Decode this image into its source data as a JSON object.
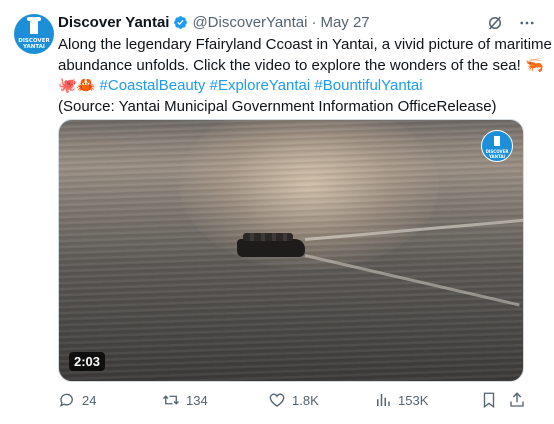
{
  "account": {
    "name": "Discover Yantai",
    "handle": "@DiscoverYantai",
    "separator": "·",
    "date": "May 27",
    "avatar_text": "DISCOVER YANTAI"
  },
  "tweet": {
    "line1": "Along the legendary Ffairyland Ccoast in Yantai, a vivid picture of maritime",
    "line2": "abundance unfolds. Click the video to explore the wonders of the sea! 🦐",
    "line3_emojis": "🐙🦀",
    "hashtags": [
      "#CoastalBeauty",
      "#ExploreYantai",
      "#BountifulYantai"
    ],
    "source": "(Source: Yantai Municipal Government Information OfficeRelease)"
  },
  "video": {
    "duration": "2:03",
    "watermark_text": "DISCOVER YANTAI"
  },
  "actions": {
    "replies": "24",
    "reposts": "134",
    "likes": "1.8K",
    "views": "153K"
  },
  "colors": {
    "accent": "#1d9bf0",
    "muted": "#536471",
    "text": "#0f1419",
    "avatar_bg": "#1c8fd8"
  },
  "icons": [
    "verified-badge-icon",
    "grok-icon",
    "more-icon",
    "reply-icon",
    "repost-icon",
    "like-icon",
    "views-icon",
    "bookmark-icon",
    "share-icon"
  ]
}
